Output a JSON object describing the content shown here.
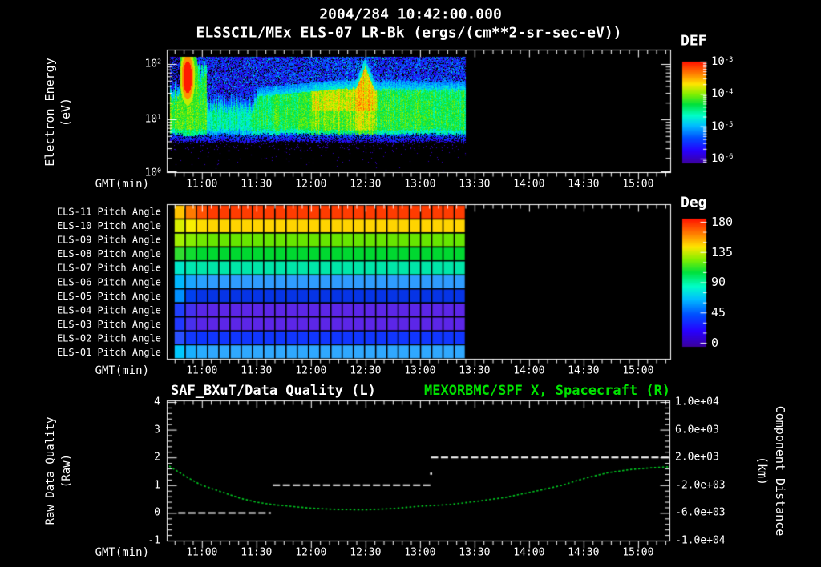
{
  "header": {
    "title_line1": "2004/284 10:42:00.000",
    "title_line2": "ELSSCIL/MEx ELS-07 LR-Bk  (ergs/(cm**2-sr-sec-eV))"
  },
  "colors": {
    "background": "#000000",
    "text": "#ffffff",
    "accent_green": "#00e400",
    "curve_green": "#00cc22",
    "frame": "#ffffff"
  },
  "time_axis": {
    "label": "GMT(min)",
    "tick_labels": [
      "11:00",
      "11:30",
      "12:00",
      "12:30",
      "13:00",
      "13:30",
      "14:00",
      "14:30",
      "15:00"
    ],
    "visible_range": [
      "10:42",
      "15:17"
    ],
    "minor_step_min": 5,
    "major_step_min": 30
  },
  "panel_spectrogram": {
    "ylabel_line1": "Electron Energy",
    "ylabel_line2": "(eV)",
    "ytick_labels": [
      "10^2",
      "10^1",
      "10^0"
    ],
    "colorbar": {
      "title": "DEF",
      "tick_labels": [
        "10^-3",
        "10^-4",
        "10^-5",
        "10^-6"
      ]
    },
    "data_time_range": [
      "10:42",
      "13:25"
    ]
  },
  "panel_pitch": {
    "row_labels": [
      "ELS-11 Pitch Angle",
      "ELS-10 Pitch Angle",
      "ELS-09 Pitch Angle",
      "ELS-08 Pitch Angle",
      "ELS-07 Pitch Angle",
      "ELS-06 Pitch Angle",
      "ELS-05 Pitch Angle",
      "ELS-04 Pitch Angle",
      "ELS-03 Pitch Angle",
      "ELS-02 Pitch Angle",
      "ELS-01 Pitch Angle"
    ],
    "colorbar": {
      "title": "Deg",
      "tick_labels": [
        "180",
        "135",
        "90",
        "45",
        "0"
      ]
    },
    "data_time_range": [
      "10:42",
      "13:25"
    ]
  },
  "panel_line": {
    "title_left": "SAF_BXuT/Data Quality (L)",
    "title_right": "MEXORBMC/SPF X, Spacecraft (R)",
    "ylabel_left_line1": "Raw Data Quality",
    "ylabel_left_line2": "(Raw)",
    "ylabel_right_line1": "Component Distance",
    "ylabel_right_line2": "(km)",
    "yticks_left": [
      "4",
      "3",
      "2",
      "1",
      "0",
      "-1"
    ],
    "yticks_right": [
      "1.0e+04",
      "6.0e+03",
      "2.0e+03",
      "-2.0e+03",
      "-6.0e+03",
      "-1.0e+04"
    ]
  },
  "chart_data": [
    {
      "type": "heatmap",
      "name": "electron-energy-spectrogram",
      "title": "ELSSCIL/MEx ELS-07 LR-Bk",
      "units": "ergs/(cm**2-sr-sec-eV)",
      "x_range": [
        "10:42",
        "15:17"
      ],
      "data_time_range": [
        "10:42",
        "13:25"
      ],
      "y_scale": "log",
      "y_range_ev": [
        1,
        180
      ],
      "color_scale": {
        "type": "log",
        "min": 1e-06,
        "max": 0.001,
        "palette": "rainbow"
      },
      "features": [
        {
          "name": "intense-burst",
          "time": "10:48",
          "energy_ev": [
            15,
            120
          ],
          "peak_flux": 0.001
        },
        {
          "name": "green-streaks",
          "time_range": [
            "10:50",
            "10:57"
          ],
          "energy_ev": [
            3,
            80
          ],
          "flux": 0.00015
        },
        {
          "name": "dim-mixed-region",
          "time_range": [
            "11:00",
            "11:25"
          ],
          "energy_ev": [
            3,
            60
          ],
          "flux": 3e-05
        },
        {
          "name": "main-thermal-band",
          "time_range": [
            "11:25",
            "13:25"
          ],
          "energy_ev": [
            4,
            25
          ],
          "flux": 0.0001
        },
        {
          "name": "enhancement",
          "time_range": [
            "12:05",
            "12:40"
          ],
          "energy_ev": [
            8,
            40
          ],
          "flux": 0.00025
        },
        {
          "name": "energy-rise-peak",
          "time": "12:33",
          "energy_ev": [
            10,
            90
          ],
          "flux": 0.00015
        },
        {
          "name": "high-energy-noise",
          "time_range": [
            "10:42",
            "13:25"
          ],
          "energy_ev": [
            30,
            140
          ],
          "flux": 3e-06
        },
        {
          "name": "dark-gap-band",
          "time_range": [
            "10:42",
            "13:25"
          ],
          "energy_ev": [
            3,
            4.5
          ],
          "flux": 1.5e-06
        }
      ]
    },
    {
      "type": "heatmap",
      "name": "pitch-angle-grid",
      "columns": 26,
      "data_time_range": [
        "10:42",
        "13:25"
      ],
      "color_scale": {
        "min": 0,
        "max": 180,
        "units": "deg"
      },
      "rows": [
        {
          "label": "ELS-11",
          "pitch_angle_deg": 165,
          "color": "#ff3c00",
          "edge_colors": [
            "#ffc400",
            "#ff7a00",
            "#ff5000"
          ]
        },
        {
          "label": "ELS-10",
          "pitch_angle_deg": 142,
          "color": "#ffd400",
          "edge_colors": [
            "#d8ee00",
            "#f8ee00",
            "#ffdc00"
          ]
        },
        {
          "label": "ELS-09",
          "pitch_angle_deg": 120,
          "color": "#66e600",
          "edge_colors": [
            "#a0f000",
            "#84ee00",
            "#70e800"
          ]
        },
        {
          "label": "ELS-08",
          "pitch_angle_deg": 103,
          "color": "#00d830",
          "edge_colors": [
            "#30dd30",
            "#10dd30",
            "#00d830"
          ]
        },
        {
          "label": "ELS-07",
          "pitch_angle_deg": 88,
          "color": "#00e6a8",
          "edge_colors": [
            "#00e8c8",
            "#00e8b0",
            "#00e6a8"
          ]
        },
        {
          "label": "ELS-06",
          "pitch_angle_deg": 58,
          "color": "#2f9cff",
          "edge_colors": [
            "#00b8ff",
            "#1aa4ff",
            "#28a0ff"
          ]
        },
        {
          "label": "ELS-05",
          "pitch_angle_deg": 36,
          "color": "#0634e6",
          "edge_colors": [
            "#0090ff",
            "#0040f0",
            "#0634e6"
          ]
        },
        {
          "label": "ELS-04",
          "pitch_angle_deg": 18,
          "color": "#5c26e8",
          "edge_colors": [
            "#2040ff",
            "#4430f0",
            "#5826e8"
          ]
        },
        {
          "label": "ELS-03",
          "pitch_angle_deg": 18,
          "color": "#5c26e8",
          "edge_colors": [
            "#2038ff",
            "#4830ee",
            "#5826e8"
          ]
        },
        {
          "label": "ELS-02",
          "pitch_angle_deg": 31,
          "color": "#1136ff",
          "edge_colors": [
            "#2a50ff",
            "#1238ff",
            "#0d34ff"
          ]
        },
        {
          "label": "ELS-01",
          "pitch_angle_deg": 56,
          "color": "#2fa8ff",
          "edge_colors": [
            "#00c8ff",
            "#18b0ff",
            "#28acff"
          ]
        }
      ]
    },
    {
      "type": "line",
      "name": "quality-and-spacecraft-distance",
      "ylim_left": [
        -1,
        4
      ],
      "ylim_right": [
        -10000,
        10000
      ],
      "series": [
        {
          "name": "SAF_BXuT/Data Quality",
          "axis": "left",
          "color": "#ffffff",
          "style": "dashed",
          "segments": [
            {
              "value": 0,
              "start": "10:47",
              "end": "11:38"
            },
            {
              "value": 1,
              "start": "11:39",
              "end": "13:06"
            },
            {
              "value": 2,
              "start": "13:06",
              "end": "15:17"
            }
          ],
          "transition_dot": {
            "t": "13:06",
            "value": 1.45
          }
        },
        {
          "name": "MEXORBMC/SPF X Spacecraft",
          "axis": "right",
          "color": "#00cc22",
          "style": "dotted",
          "points_km": [
            [
              "10:42",
              750
            ],
            [
              "10:52",
              -870
            ],
            [
              "10:59",
              -1900
            ],
            [
              "11:08",
              -2720
            ],
            [
              "11:21",
              -3880
            ],
            [
              "11:30",
              -4450
            ],
            [
              "11:39",
              -4800
            ],
            [
              "11:48",
              -5030
            ],
            [
              "12:00",
              -5320
            ],
            [
              "12:14",
              -5500
            ],
            [
              "12:30",
              -5550
            ],
            [
              "12:45",
              -5380
            ],
            [
              "13:00",
              -5030
            ],
            [
              "13:16",
              -4800
            ],
            [
              "13:31",
              -4340
            ],
            [
              "13:47",
              -3760
            ],
            [
              "14:02",
              -2950
            ],
            [
              "14:18",
              -2030
            ],
            [
              "14:31",
              -980
            ],
            [
              "14:44",
              -170
            ],
            [
              "14:57",
              290
            ],
            [
              "15:08",
              520
            ],
            [
              "15:17",
              640
            ]
          ]
        }
      ]
    }
  ]
}
